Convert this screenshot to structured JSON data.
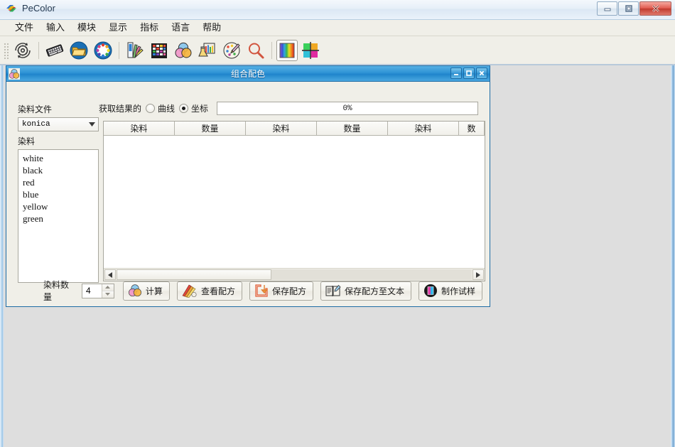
{
  "app": {
    "title": "PeColor",
    "icon": "pecolor-logo-icon",
    "window_controls": [
      {
        "name": "minimize-button",
        "glyph": "minimize-icon"
      },
      {
        "name": "maximize-button",
        "glyph": "maximize-icon"
      },
      {
        "name": "close-button",
        "glyph": "close-icon"
      }
    ]
  },
  "menubar": {
    "items": [
      {
        "label": "文件"
      },
      {
        "label": "输入"
      },
      {
        "label": "模块"
      },
      {
        "label": "显示"
      },
      {
        "label": "指标"
      },
      {
        "label": "语言"
      },
      {
        "label": "帮助"
      }
    ]
  },
  "toolbar": {
    "buttons": [
      {
        "name": "settings-gear-icon"
      },
      {
        "name": "keyboard-icon"
      },
      {
        "name": "folder-open-icon"
      },
      {
        "name": "color-wheel-icon"
      },
      {
        "name": "color-swatch-fan-icon"
      },
      {
        "name": "color-chart-grid-icon"
      },
      {
        "name": "color-mixing-venn-icon"
      },
      {
        "name": "lab-flask-icon"
      },
      {
        "name": "palette-brush-icon"
      },
      {
        "name": "magnifier-icon"
      },
      {
        "name": "spectrum-bars-icon"
      },
      {
        "name": "color-crosshair-icon"
      }
    ]
  },
  "child_window": {
    "title": "组合配色",
    "icon": "color-mixing-venn-icon",
    "controls": [
      {
        "name": "child-minimize-button",
        "glyph": "minimize-icon"
      },
      {
        "name": "child-maximize-button",
        "glyph": "maximize-icon"
      },
      {
        "name": "child-close-button",
        "glyph": "close-icon"
      }
    ],
    "left_panel": {
      "dye_file_label": "染料文件",
      "dye_file_selected": "konica",
      "dye_label": "染料",
      "dye_items": [
        "white",
        "black",
        "red",
        "blue",
        "yellow",
        "green"
      ]
    },
    "result_row": {
      "label": "获取结果的",
      "options": [
        {
          "label": "曲线",
          "checked": false
        },
        {
          "label": "坐标",
          "checked": true
        }
      ],
      "progress_text": "0%",
      "progress_percent": 0
    },
    "grid": {
      "columns": [
        "染料",
        "数量",
        "染料",
        "数量",
        "染料",
        "数"
      ],
      "rows": []
    },
    "bottom_bar": {
      "count_label": "染料数量",
      "count_value": "4",
      "buttons": [
        {
          "label": "计算",
          "icon": "color-mixing-venn-icon"
        },
        {
          "label": "查看配方",
          "icon": "swatch-fan-icon"
        },
        {
          "label": "保存配方",
          "icon": "save-down-icon"
        },
        {
          "label": "保存配方至文本",
          "icon": "text-document-icon"
        },
        {
          "label": "制作试样",
          "icon": "sample-sphere-icon"
        }
      ]
    }
  },
  "colors": {
    "frame_blue": "#2e93d5",
    "toolbar_bg": "#f0efe8",
    "mdi_bg": "#dedede",
    "close_red": "#c03a2e"
  }
}
